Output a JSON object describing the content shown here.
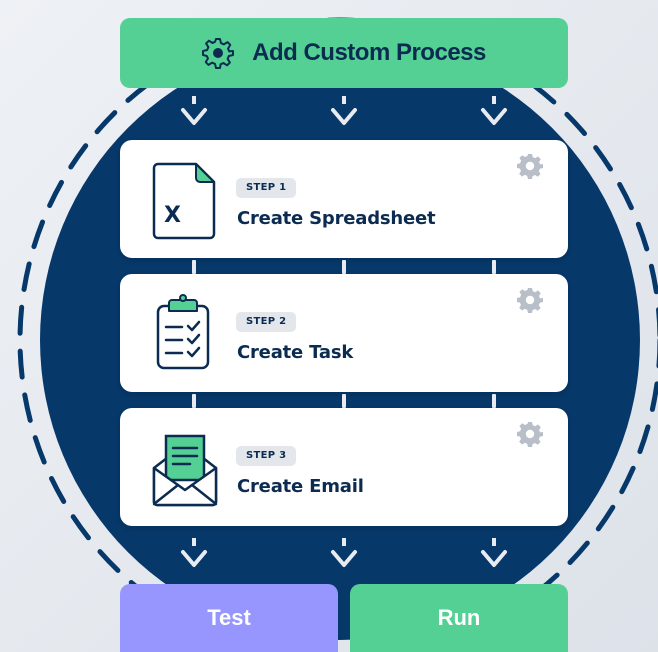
{
  "header": {
    "title": "Add Custom Process",
    "icon": "gear-icon"
  },
  "steps": [
    {
      "badge": "STEP 1",
      "title": "Create Spreadsheet",
      "icon": "spreadsheet-file-icon",
      "file_letter": "X"
    },
    {
      "badge": "STEP 2",
      "title": "Create Task",
      "icon": "task-clipboard-icon"
    },
    {
      "badge": "STEP 3",
      "title": "Create Email",
      "icon": "email-envelope-icon"
    }
  ],
  "actions": {
    "test_label": "Test",
    "run_label": "Run"
  },
  "colors": {
    "background": "#e7ebf0",
    "circle": "#06386a",
    "green": "#54d094",
    "purple": "#9796ff",
    "text_dark": "#0b2c50",
    "badge_bg": "#e3e7ec"
  }
}
